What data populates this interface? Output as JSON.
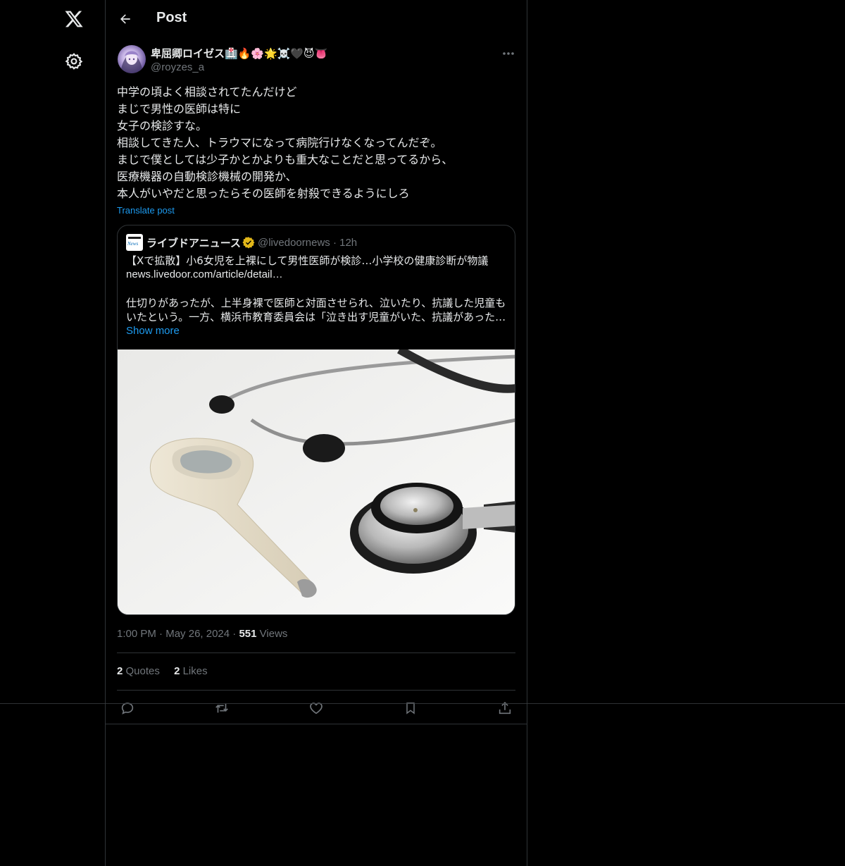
{
  "header": {
    "title": "Post"
  },
  "post": {
    "display_name": "卑屈卿ロイゼス🏥🔥🌸🌟☠️🖤😈👅",
    "handle": "@royzes_a",
    "text_lines": [
      "中学の頃よく相談されてたんだけど",
      "まじで男性の医師は特に",
      "女子の検診すな。",
      "相談してきた人、トラウマになって病院行けなくなってんだぞ。",
      "まじで僕としては少子かとかよりも重大なことだと思ってるから、",
      "医療機器の自動検診機械の開発か、",
      "本人がいやだと思ったらその医師を射殺できるようにしろ"
    ],
    "translate_label": "Translate post",
    "time": "1:00 PM",
    "date": "May 26, 2024",
    "views_count": "551",
    "views_label": "Views",
    "quotes_count": "2",
    "quotes_label": "Quotes",
    "likes_count": "2",
    "likes_label": "Likes"
  },
  "quote": {
    "avatar_word": "News",
    "name": "ライブドアニュース",
    "handle": "@livedoornews",
    "time": "12h",
    "headline": "【Xで拡散】小6女児を上裸にして男性医師が検診…小学校の健康診断が物議",
    "link": "news.livedoor.com/article/detail…",
    "body_line1": "仕切りがあったが、上半身裸で医師と対面させられ、泣いたり、抗議した児童も",
    "body_line2": "いたという。一方、横浜市教育委員会は「泣き出す児童がいた、抗議があった…",
    "show_more": "Show more"
  },
  "icons": {
    "logo": "x-logo-icon",
    "settings": "gear-icon",
    "back": "arrow-left-icon",
    "more": "more-horizontal-icon",
    "verified": "verified-badge-icon",
    "reply": "reply-icon",
    "repost": "repost-icon",
    "like": "heart-icon",
    "bookmark": "bookmark-icon",
    "share": "share-icon"
  },
  "colors": {
    "background": "#000000",
    "text": "#e7e9ea",
    "muted": "#71767b",
    "accent": "#1d9bf0",
    "verified_gold": "#e2b719",
    "border": "#2f3336"
  }
}
